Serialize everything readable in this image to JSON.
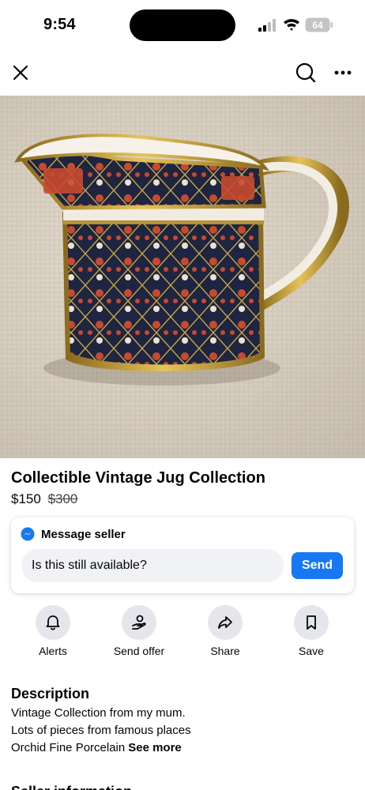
{
  "status_bar": {
    "time": "9:54",
    "battery": "64"
  },
  "listing": {
    "title": "Collectible Vintage Jug Collection",
    "price": "$150",
    "original_price": "$300",
    "photo_count": 9,
    "active_photo_index": 8
  },
  "message": {
    "heading": "Message seller",
    "input_value": "Is this still available?",
    "send_label": "Send"
  },
  "actions": [
    {
      "label": "Alerts",
      "icon": "bell-icon"
    },
    {
      "label": "Send offer",
      "icon": "offer-icon"
    },
    {
      "label": "Share",
      "icon": "share-icon"
    },
    {
      "label": "Save",
      "icon": "bookmark-icon"
    }
  ],
  "description": {
    "title": "Description",
    "lines": [
      "Vintage Collection from my mum.",
      "Lots of pieces from famous places",
      "Orchid Fine Porcelain"
    ],
    "see_more": "See more"
  },
  "seller_heading": "Seller information",
  "colors": {
    "accent": "#1877f2",
    "action_bg": "#e4e6eb",
    "input_bg": "#f0f2f5"
  }
}
